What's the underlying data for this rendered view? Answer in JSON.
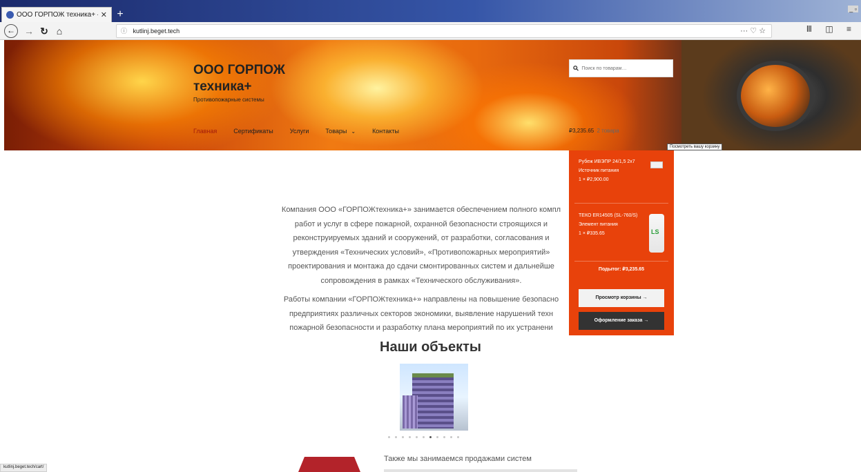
{
  "browser": {
    "tab_title": "ООО ГОРПОЖ техника+ — Прот",
    "tab_close": "✕",
    "new_tab": "+",
    "url": "kutlinj.beget.tech",
    "url_actions": "··· ♡ ☆",
    "tools": "Ⅲ ◫ ≡",
    "status_url": "kutlinj.beget.tech/cart/"
  },
  "header": {
    "title_line1": "ООО ГОРПОЖ",
    "title_line2": "техника+",
    "description": "Противопожарные системы",
    "search_placeholder": "Поиск по товарам…",
    "menu": [
      {
        "label": "Главная"
      },
      {
        "label": "Сертификаты"
      },
      {
        "label": "Услуги"
      },
      {
        "label": "Товары"
      },
      {
        "label": "Контакты"
      }
    ],
    "cart_total": "₽3,235.65",
    "cart_count": "2 товара",
    "cart_tooltip": "Посмотреть вашу корзину"
  },
  "cart": {
    "items": [
      {
        "name": "Рубеж ИВЭПР 24/1,5 2х7 Источник питания",
        "qty": "1 × ₽2,900.00"
      },
      {
        "name": "ТЕКО ER14505 (SL-760/S) Элемент питания",
        "qty": "1 × ₽335.65"
      }
    ],
    "subtotal": "Подытог: ₽3,235.65",
    "view_cart": "Просмотр корзины →",
    "checkout": "Оформление заказа →"
  },
  "main": {
    "intro_lines": [
      "Компания ООО «ГОРПОЖтехника+» занимается обеспечением полного компл",
      "работ и услуг в сфере пожарной, охранной безопасности строящихся и",
      "реконструируемых зданий и сооружений, от разработки, согласования и",
      "утверждения «Технических условий», «Противопожарных мероприятий»",
      "проектирования и монтажа до сдачи смонтированных систем и дальнейше",
      "сопровождения в рамках «Технического обслуживания»."
    ],
    "intro2_lines": [
      "Работы компании «ГОРПОЖтехника+» направлены на повышение безопасно",
      "предприятиях различных секторов экономики, выявление нарушений техн",
      "пожарной безопасности и разработку плана мероприятий по их устранени"
    ],
    "objects_title": "Наши объекты",
    "slider_dots": 11,
    "slider_active": 6,
    "bottom_text": "Также мы занимаемся продажами систем"
  }
}
